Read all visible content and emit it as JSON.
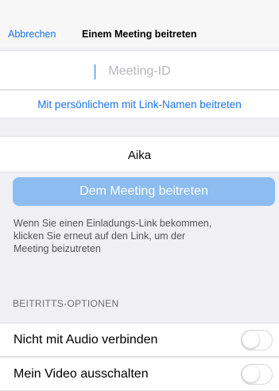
{
  "nav": {
    "cancel_label": "Abbrechen",
    "title": "Einem Meeting beitreten"
  },
  "meeting_id": {
    "value": "",
    "placeholder": "Meeting-ID"
  },
  "personal_link_label": "Mit persönlichem mit Link-Namen beitreten",
  "display_name": "Aika",
  "join_button_label": "Dem Meeting beitreten",
  "info_lines": [
    "Wenn Sie einen Einladungs-Link bekommen,",
    "klicken Sie erneut auf den Link, um der",
    "Meeting beizutreten"
  ],
  "options": {
    "section_title": "BEITRITTS-OPTIONEN",
    "items": [
      {
        "label": "Nicht mit Audio verbinden",
        "on": false
      },
      {
        "label": "Mein Video ausschalten",
        "on": false
      }
    ]
  },
  "colors": {
    "accent": "#1a73e8",
    "join_button_disabled": "#8cbcf0",
    "background": "#efeff4"
  }
}
